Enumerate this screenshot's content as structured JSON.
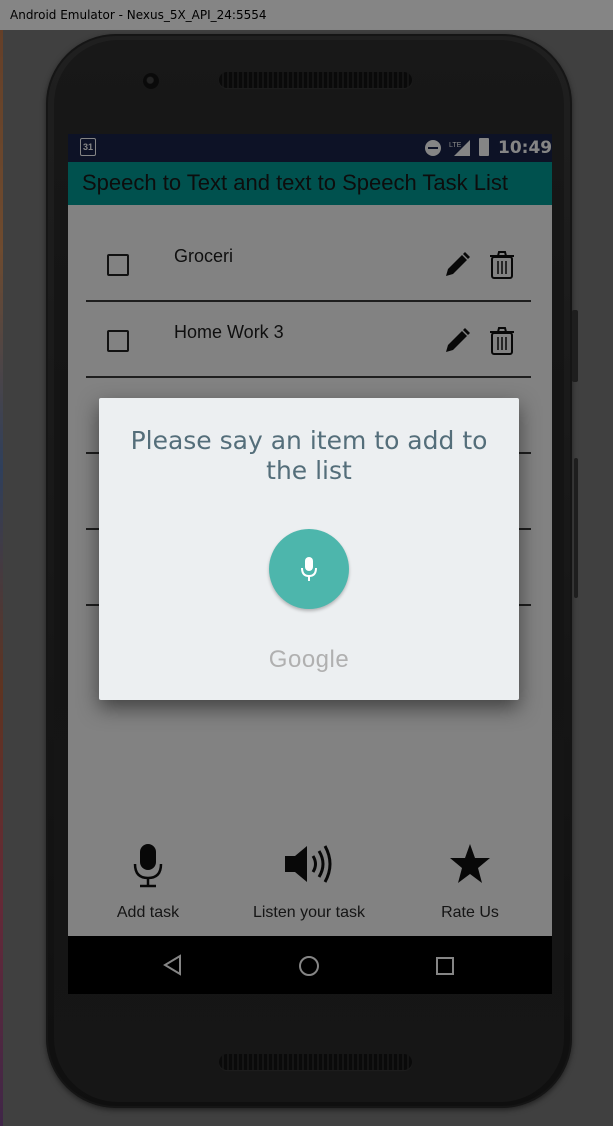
{
  "window": {
    "title": "Android Emulator - Nexus_5X_API_24:5554"
  },
  "status_bar": {
    "calendar_day": "31",
    "network": "LTE",
    "time": "10:49"
  },
  "app": {
    "title": "Speech to Text and text to Speech Task List"
  },
  "tasks": [
    {
      "label": "Groceri",
      "checked": false
    },
    {
      "label": "Home Work 3",
      "checked": false
    }
  ],
  "bottom_actions": [
    {
      "label": "Add task",
      "icon": "microphone-icon"
    },
    {
      "label": "Listen your task",
      "icon": "speaker-icon"
    },
    {
      "label": "Rate Us",
      "icon": "star-icon"
    }
  ],
  "speech_dialog": {
    "prompt": "Please say an item to add to the list",
    "brand": "Google",
    "mic_color": "#4db6ac"
  },
  "colors": {
    "app_bar": "#009b96",
    "status_bar": "#1a2349"
  }
}
